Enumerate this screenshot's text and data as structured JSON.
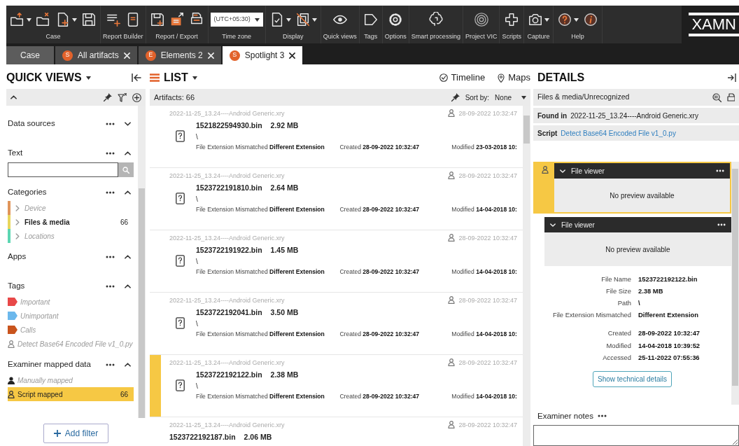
{
  "toolbar": {
    "groups": [
      {
        "label": "Case",
        "tools": [
          {
            "dropdown": true
          },
          {
            "dropdown": false
          },
          {
            "dropdown": true
          },
          {
            "dropdown": false
          }
        ]
      },
      {
        "label": "Report Builder",
        "tools": [
          {
            "dropdown": false
          },
          {
            "dropdown": false
          }
        ]
      },
      {
        "label": "Report / Export",
        "tools": [
          {
            "dropdown": false
          },
          {
            "dropdown": false
          },
          {
            "dropdown": false
          }
        ]
      },
      {
        "label": "Time zone",
        "select": "(UTC+05:30)"
      },
      {
        "label": "Display",
        "tools": [
          {
            "dropdown": true
          },
          {
            "dropdown": true
          }
        ]
      },
      {
        "label": "Quick views",
        "tools": [
          {
            "dropdown": false
          }
        ]
      },
      {
        "label": "Tags",
        "tools": [
          {
            "dropdown": false
          }
        ]
      },
      {
        "label": "Options",
        "tools": [
          {
            "dropdown": false
          }
        ]
      },
      {
        "label": "Smart processing",
        "tools": [
          {
            "dropdown": false
          }
        ]
      },
      {
        "label": "Project VIC",
        "tools": [
          {
            "dropdown": false
          }
        ]
      },
      {
        "label": "Scripts",
        "tools": [
          {
            "dropdown": false
          }
        ]
      },
      {
        "label": "Capture",
        "tools": [
          {
            "dropdown": true
          }
        ]
      },
      {
        "label": "Help",
        "tools": [
          {
            "dropdown": true
          },
          {
            "dropdown": false
          }
        ]
      }
    ],
    "logo": "XAMN"
  },
  "tabs": [
    {
      "label": "Case",
      "closable": false,
      "selected": false
    },
    {
      "label": "All artifacts",
      "badge": "S",
      "closable": true,
      "selected": false
    },
    {
      "label": "Elements 2",
      "badge": "E",
      "closable": true,
      "selected": false
    },
    {
      "label": "Spotlight 3",
      "badge": "S",
      "closable": true,
      "selected": true
    }
  ],
  "quick_views": {
    "title": "QUICK VIEWS",
    "sections": [
      {
        "title": "Data sources",
        "expanded": false
      },
      {
        "title": "Text",
        "expanded": true,
        "kind": "search"
      },
      {
        "title": "Categories",
        "expanded": true,
        "items": [
          {
            "kind": "category",
            "label": "Device",
            "color": "#e0955a",
            "enabled": false,
            "selected": false
          },
          {
            "kind": "category",
            "label": "Files & media",
            "color": "#e8d65c",
            "enabled": true,
            "count": "66",
            "selected": false
          },
          {
            "kind": "category",
            "label": "Locations",
            "color": "#5cd6b2",
            "enabled": false,
            "selected": false
          }
        ]
      },
      {
        "title": "Apps",
        "expanded": true
      },
      {
        "title": "Tags",
        "expanded": true,
        "items": [
          {
            "kind": "tag",
            "label": "Important",
            "color": "#e84848",
            "enabled": false,
            "selected": false
          },
          {
            "kind": "tag",
            "label": "Unimportant",
            "color": "#6cb8ec",
            "enabled": false,
            "selected": false
          },
          {
            "kind": "tag",
            "label": "Calls",
            "color": "#c9541d",
            "enabled": false,
            "selected": false
          },
          {
            "kind": "script",
            "label": "Detect Base64 Encoded File v1_0.py",
            "enabled": false,
            "selected": false
          }
        ]
      },
      {
        "title": "Examiner mapped data",
        "expanded": true,
        "items": [
          {
            "kind": "manual",
            "label": "Manually mapped",
            "enabled": false,
            "selected": false
          },
          {
            "kind": "script",
            "label": "Script mapped",
            "enabled": true,
            "count": "66",
            "selected": true
          }
        ]
      }
    ],
    "add_filter": "Add filter"
  },
  "list": {
    "title": "LIST",
    "views": [
      {
        "kind": "timeline",
        "label": "Timeline"
      },
      {
        "kind": "map",
        "label": "Maps"
      }
    ],
    "count_label": "Artifacts: 66",
    "sort_label": "Sort by:",
    "sort_value": "None",
    "rows": [
      {
        "source": "2022-11-25_13.24----Android Generic.xry",
        "date": "28-09-2022 10:32:47",
        "name": "1521822594930.bin",
        "size": "2.92 MB",
        "path": "\\",
        "fields": [
          {
            "label": "File Extension Mismatched",
            "value": "Different Extension"
          },
          {
            "label": "Created",
            "value": "28-09-2022 10:32:47"
          },
          {
            "label": "Modified",
            "value": "23-03-2018 10:"
          }
        ],
        "selected": false
      },
      {
        "source": "2022-11-25_13.24----Android Generic.xry",
        "date": "28-09-2022 10:32:47",
        "name": "1523722191810.bin",
        "size": "2.64 MB",
        "path": "\\",
        "fields": [
          {
            "label": "File Extension Mismatched",
            "value": "Different Extension"
          },
          {
            "label": "Created",
            "value": "28-09-2022 10:32:47"
          },
          {
            "label": "Modified",
            "value": "14-04-2018 10:"
          }
        ],
        "selected": false
      },
      {
        "source": "2022-11-25_13.24----Android Generic.xry",
        "date": "28-09-2022 10:32:47",
        "name": "1523722191922.bin",
        "size": "1.45 MB",
        "path": "\\",
        "fields": [
          {
            "label": "File Extension Mismatched",
            "value": "Different Extension"
          },
          {
            "label": "Created",
            "value": "28-09-2022 10:32:47"
          },
          {
            "label": "Modified",
            "value": "14-04-2018 10:"
          }
        ],
        "selected": false
      },
      {
        "source": "2022-11-25_13.24----Android Generic.xry",
        "date": "28-09-2022 10:32:47",
        "name": "1523722192041.bin",
        "size": "3.50 MB",
        "path": "\\",
        "fields": [
          {
            "label": "File Extension Mismatched",
            "value": "Different Extension"
          },
          {
            "label": "Created",
            "value": "28-09-2022 10:32:47"
          },
          {
            "label": "Modified",
            "value": "14-04-2018 10:"
          }
        ],
        "selected": false
      },
      {
        "source": "2022-11-25_13.24----Android Generic.xry",
        "date": "28-09-2022 10:32:47",
        "name": "1523722192122.bin",
        "size": "2.38 MB",
        "path": "\\",
        "fields": [
          {
            "label": "File Extension Mismatched",
            "value": "Different Extension"
          },
          {
            "label": "Created",
            "value": "28-09-2022 10:32:47"
          },
          {
            "label": "Modified",
            "value": "14-04-2018 10:"
          }
        ],
        "selected": true
      },
      {
        "source": "2022-11-25_13.24----Android Generic.xry",
        "date": "28-09-2022 10:32:47",
        "name": "1523722192187.bin",
        "size": "2.06 MB",
        "selected": false
      }
    ]
  },
  "details": {
    "title": "DETAILS",
    "category": "Files & media/Unrecognized",
    "found_in": {
      "label": "Found in",
      "value": "2022-11-25_13.24----Android Generic.xry"
    },
    "script": {
      "label": "Script",
      "value": "Detect Base64 Encoded File v1_0.py"
    },
    "viewers": [
      {
        "title": "File viewer",
        "message": "No preview available",
        "selected": true
      },
      {
        "title": "File viewer",
        "message": "No preview available",
        "selected": false
      }
    ],
    "property_groups": [
      {
        "rows": [
          {
            "label": "File Name",
            "value": "1523722192122.bin"
          },
          {
            "label": "File Size",
            "value": "2.38 MB"
          },
          {
            "label": "Path",
            "value": "\\"
          },
          {
            "label": "File Extension Mismatched",
            "value": "Different Extension"
          }
        ]
      },
      {
        "rows": [
          {
            "label": "Created",
            "value": "28-09-2022 10:32:47"
          },
          {
            "label": "Modified",
            "value": "14-04-2018 10:39:52"
          },
          {
            "label": "Accessed",
            "value": "25-11-2022 07:55:36"
          }
        ]
      }
    ],
    "technical_button": "Show technical details",
    "notes_title": "Examiner notes"
  }
}
